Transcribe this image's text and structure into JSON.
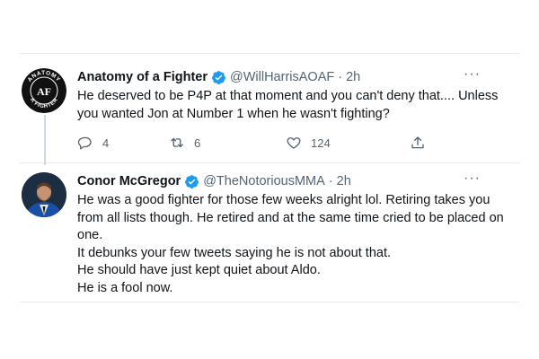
{
  "tweets": [
    {
      "name": "Anatomy of a Fighter",
      "handle": "@WillHarrisAOAF",
      "dot": "·",
      "time": "2h",
      "more": "···",
      "avatar_text": {
        "top": "ANATOMY",
        "bottom": "A FIGHTER",
        "left": "OF",
        "mark": "AF"
      },
      "lines": [
        "He deserved to be P4P at that moment and you can't deny that.... Unless",
        "you wanted Jon at Number 1 when he wasn't fighting?"
      ],
      "actions": {
        "replies": "4",
        "retweets": "6",
        "likes": "124"
      }
    },
    {
      "name": "Conor McGregor",
      "handle": "@TheNotoriousMMA",
      "dot": "·",
      "time": "2h",
      "more": "···",
      "lines": [
        "He was a good fighter for those few weeks alright lol. Retiring takes you",
        "from all lists though. He retired and at the same time cried to be placed on",
        "one.",
        "It debunks your few tweets saying he is not about that.",
        "He should have just kept quiet about Aldo.",
        "He is a fool now."
      ]
    }
  ],
  "colors": {
    "verified": "#1d9bf0",
    "secondary": "#536471",
    "text": "#0f1419"
  }
}
